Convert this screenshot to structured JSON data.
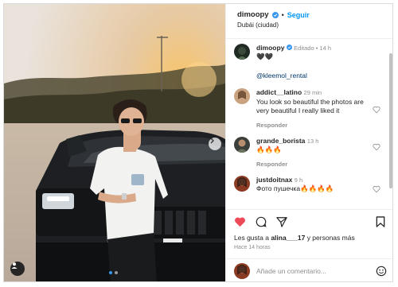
{
  "post": {
    "author": "dimoopy",
    "follow_label": "Seguir",
    "location": "Dubái (ciudad)",
    "separator": "•",
    "caption_meta": "Editado • 14 h",
    "caption_text": "🖤🖤",
    "caption_mention": "@kleemol_rental"
  },
  "comments": [
    {
      "user": "addict__latino",
      "time": "29 min",
      "text": "You look so beautiful the photos are very beautiful I really liked it",
      "reply": "Responder"
    },
    {
      "user": "grande_borista",
      "time": "13 h",
      "text": "🔥🔥🔥",
      "reply": "Responder"
    },
    {
      "user": "justdoitnax",
      "time": "9 h",
      "text": "Фото пушечка🔥🔥🔥🔥",
      "reply": ""
    }
  ],
  "likes_text_prefix": "Les gusta a ",
  "likes_user": "alina___17",
  "likes_text_suffix": " y personas más",
  "posted_ago": "Hace 14 horas",
  "comment_placeholder": "Añade un comentario...",
  "colors": {
    "accent": "#0095f6",
    "like_red": "#ed4956",
    "verified": "#3897f0"
  }
}
